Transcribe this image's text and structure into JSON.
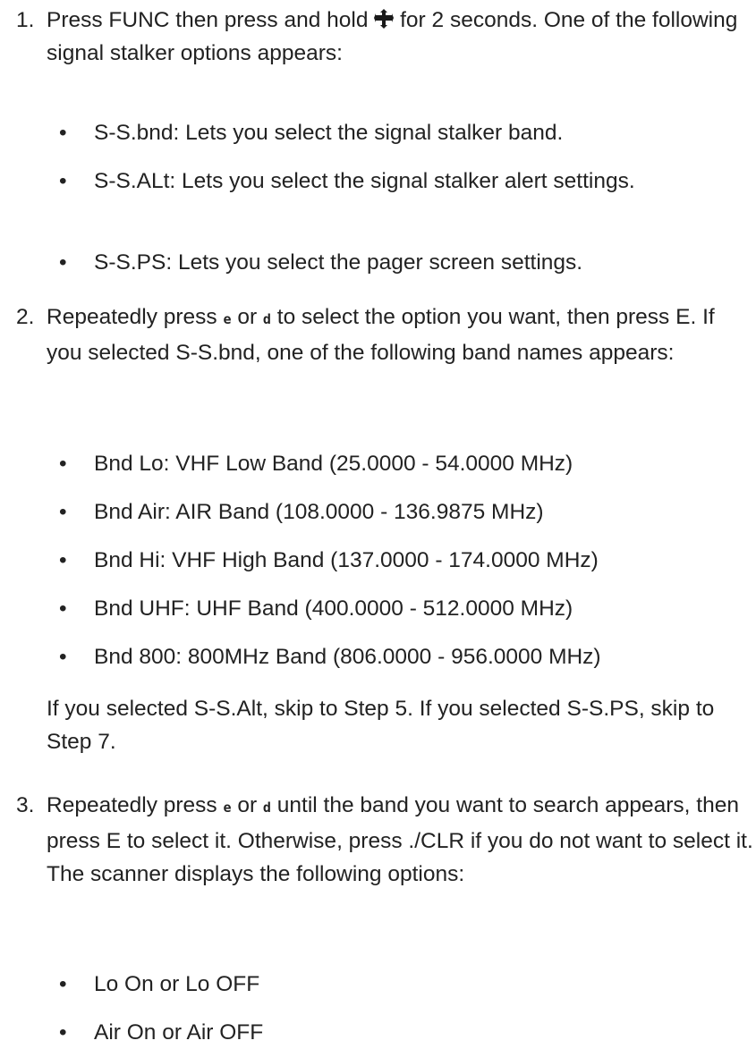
{
  "steps": [
    {
      "number": "1.",
      "text_before_icon": "Press FUNC then press and hold ",
      "icon": "function-key-icon",
      "text_after_icon": " for 2 seconds. One of the following signal stalker options appears:",
      "bullets": [
        "S-S.bnd: Lets you select the signal stalker band.",
        "S-S.ALt: Lets you select the signal stalker alert settings.",
        "S-S.PS: Lets you select the pager screen settings."
      ]
    },
    {
      "number": "2.",
      "seg1": "Repeatedly press ",
      "key1": "e",
      "seg2": " or ",
      "key2": "d",
      "seg3": " to select the option you want, then press E. If you selected S-S.bnd, one of the following band names appears:",
      "bullets": [
        "Bnd Lo: VHF Low Band (25.0000 - 54.0000 MHz)",
        "Bnd Air: AIR Band (108.0000 - 136.9875 MHz)",
        "Bnd Hi: VHF High Band (137.0000 - 174.0000 MHz)",
        "Bnd UHF: UHF Band (400.0000 - 512.0000 MHz)",
        "Bnd 800: 800MHz Band (806.0000 - 956.0000 MHz)"
      ],
      "after_text": "If you selected S-S.Alt, skip to Step 5. If you selected S-S.PS, skip to Step 7."
    },
    {
      "number": "3.",
      "seg1": "Repeatedly press ",
      "key1": "e",
      "seg2": " or ",
      "key2": "d",
      "seg3": " until the band you want to search appears, then press E to select it. Otherwise, press ./CLR if you do not want to select it. The scanner displays the following options:",
      "bullets": [
        "Lo On or Lo OFF",
        "Air On or Air OFF"
      ]
    }
  ]
}
